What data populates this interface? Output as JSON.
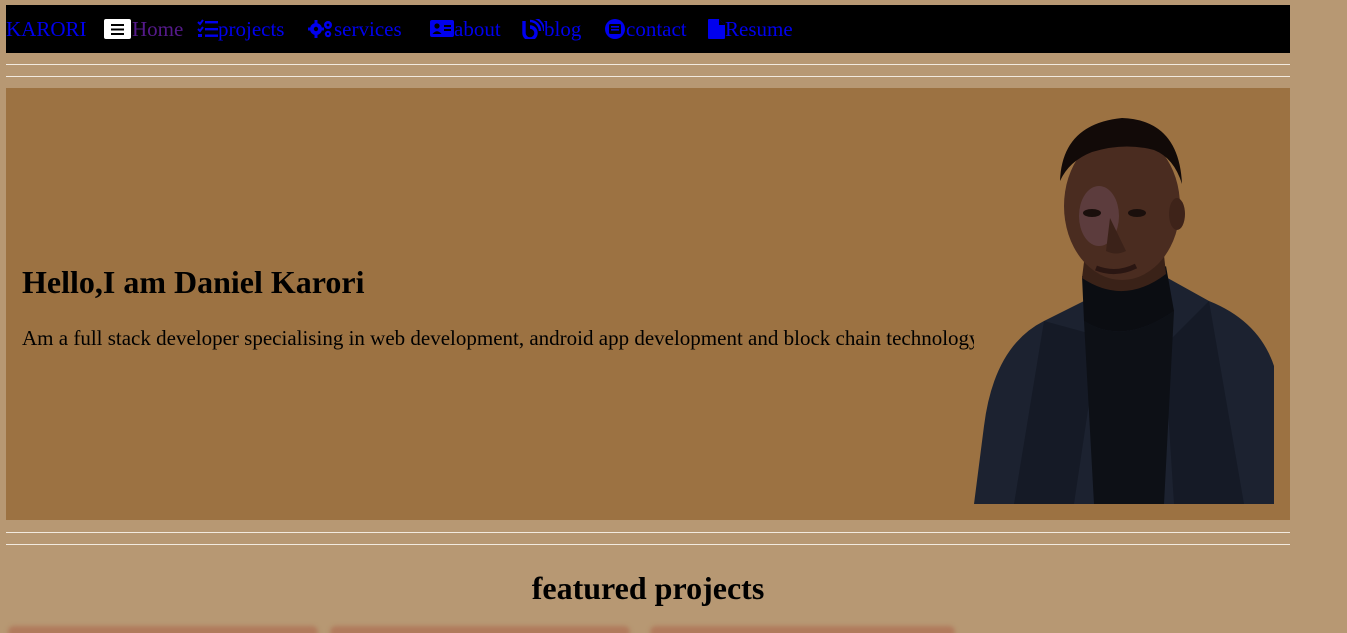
{
  "nav": {
    "brand": "KARORI",
    "items": [
      {
        "label": "Home",
        "icon": "home-icon"
      },
      {
        "label": "projects",
        "icon": "list-check-icon"
      },
      {
        "label": "services",
        "icon": "gears-icon"
      },
      {
        "label": "about",
        "icon": "id-card-icon"
      },
      {
        "label": "blog",
        "icon": "blog-icon"
      },
      {
        "label": "contact",
        "icon": "contact-icon"
      },
      {
        "label": "Resume",
        "icon": "file-icon"
      }
    ],
    "menu_icon": "hamburger-icon"
  },
  "hero": {
    "title": "Hello,I am Daniel Karori",
    "text": "Am a full stack developer specialising in web development, android app development and block chain technology.",
    "portrait_icon": "portrait-photo"
  },
  "featured": {
    "title": "featured projects"
  },
  "colors": {
    "page_bg": "#b79873",
    "hero_bg": "#9c7242",
    "nav_bg": "#000000",
    "link": "#0000ee",
    "link_visited": "#551a8b"
  }
}
